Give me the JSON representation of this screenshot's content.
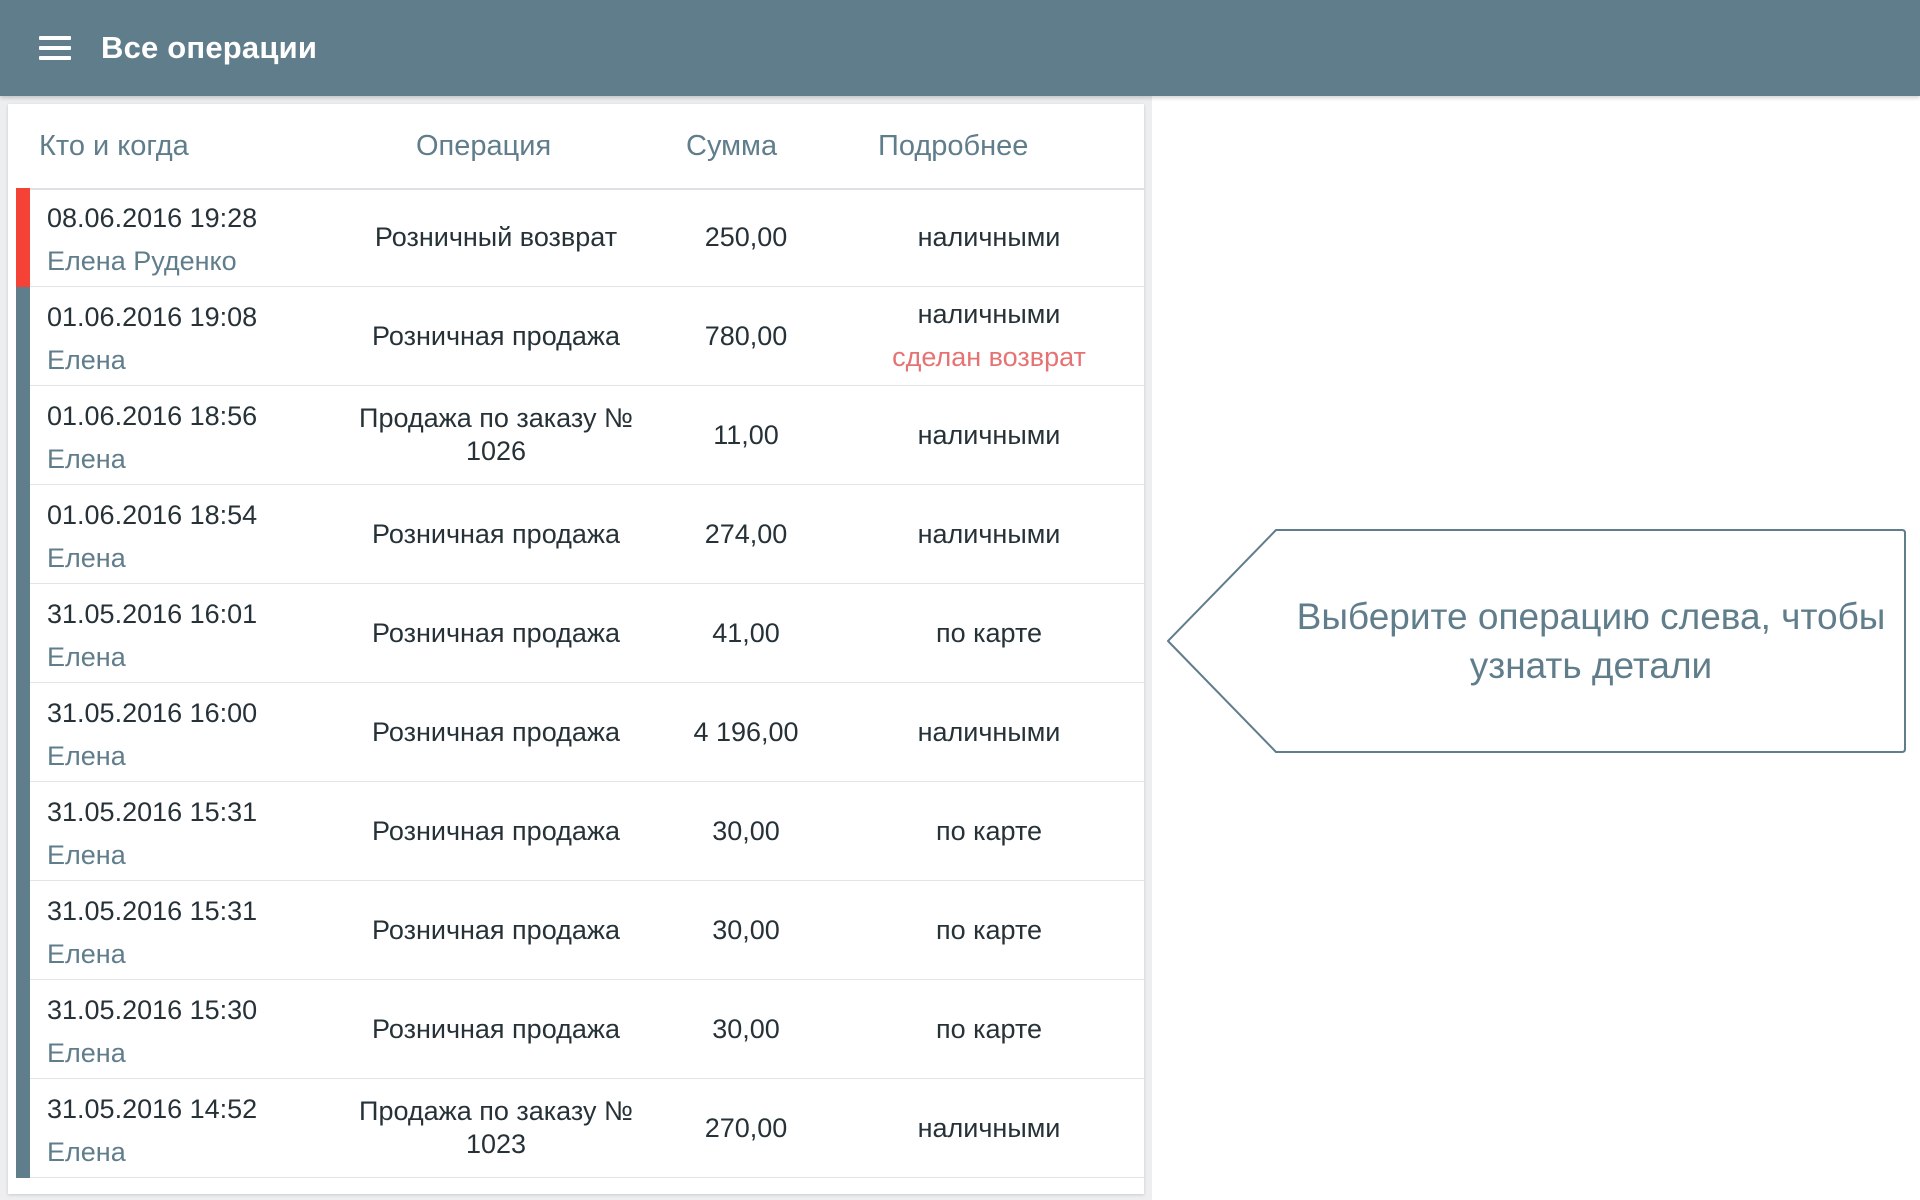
{
  "header": {
    "title": "Все операции",
    "menu_icon": "hamburger-menu-icon"
  },
  "table": {
    "columns": {
      "who": "Кто и когда",
      "operation": "Операция",
      "amount": "Сумма",
      "details": "Подробнее"
    },
    "rows": [
      {
        "datetime": "08.06.2016 19:28",
        "user": "Елена Руденко",
        "operation": "Розничный возврат",
        "amount": "250,00",
        "details": "наличными",
        "note": "",
        "stripe": "#f44336"
      },
      {
        "datetime": "01.06.2016 19:08",
        "user": "Елена",
        "operation": "Розничная продажа",
        "amount": "780,00",
        "details": "наличными",
        "note": "сделан возврат",
        "stripe": "#607d8b"
      },
      {
        "datetime": "01.06.2016 18:56",
        "user": "Елена",
        "operation": "Продажа по заказу № 1026",
        "amount": "11,00",
        "details": "наличными",
        "note": "",
        "stripe": "#607d8b"
      },
      {
        "datetime": "01.06.2016 18:54",
        "user": "Елена",
        "operation": "Розничная продажа",
        "amount": "274,00",
        "details": "наличными",
        "note": "",
        "stripe": "#607d8b"
      },
      {
        "datetime": "31.05.2016 16:01",
        "user": "Елена",
        "operation": "Розничная продажа",
        "amount": "41,00",
        "details": "по карте",
        "note": "",
        "stripe": "#607d8b"
      },
      {
        "datetime": "31.05.2016 16:00",
        "user": "Елена",
        "operation": "Розничная продажа",
        "amount": "4 196,00",
        "details": "наличными",
        "note": "",
        "stripe": "#607d8b"
      },
      {
        "datetime": "31.05.2016 15:31",
        "user": "Елена",
        "operation": "Розничная продажа",
        "amount": "30,00",
        "details": "по карте",
        "note": "",
        "stripe": "#607d8b"
      },
      {
        "datetime": "31.05.2016 15:31",
        "user": "Елена",
        "operation": "Розничная продажа",
        "amount": "30,00",
        "details": "по карте",
        "note": "",
        "stripe": "#607d8b"
      },
      {
        "datetime": "31.05.2016 15:30",
        "user": "Елена",
        "operation": "Розничная продажа",
        "amount": "30,00",
        "details": "по карте",
        "note": "",
        "stripe": "#607d8b"
      },
      {
        "datetime": "31.05.2016 14:52",
        "user": "Елена",
        "operation": "Продажа по заказу № 1023",
        "amount": "270,00",
        "details": "наличными",
        "note": "",
        "stripe": "#607d8b"
      }
    ]
  },
  "detail": {
    "hint": "Выберите операцию слева, чтобы узнать детали"
  },
  "colors": {
    "appbar": "#607d8b",
    "accent": "#607d8b",
    "refund": "#f44336",
    "note": "#e57373"
  }
}
